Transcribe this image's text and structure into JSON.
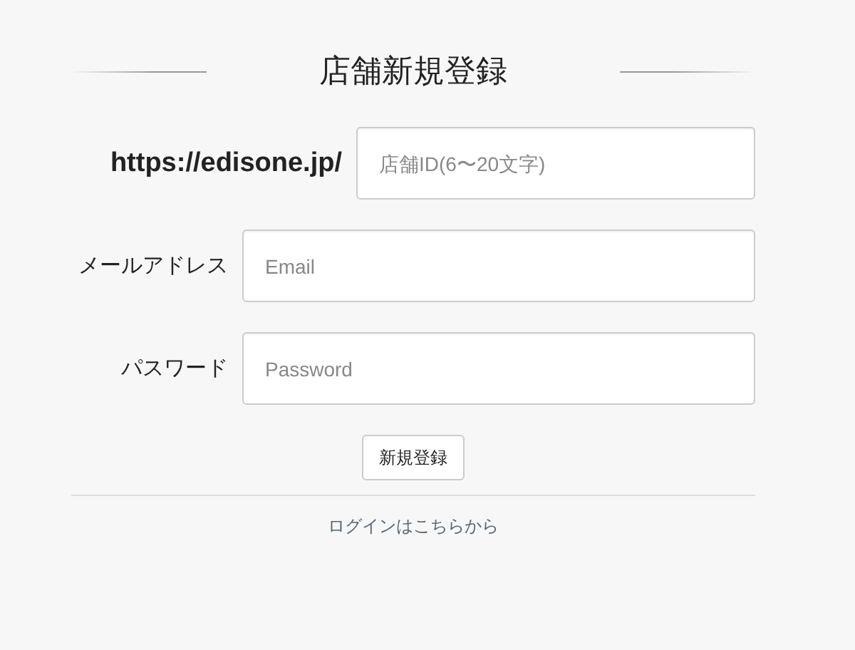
{
  "title": "店舗新規登録",
  "fields": [
    {
      "kind": "url",
      "label": "https://edisone.jp/",
      "placeholder": "店舗ID(6〜20文字)"
    },
    {
      "kind": "email",
      "label": "メールアドレス",
      "placeholder": "Email"
    },
    {
      "kind": "password",
      "label": "パスワード",
      "placeholder": "Password"
    }
  ],
  "submit": "新規登録",
  "login_link": "ログインはこちらから"
}
